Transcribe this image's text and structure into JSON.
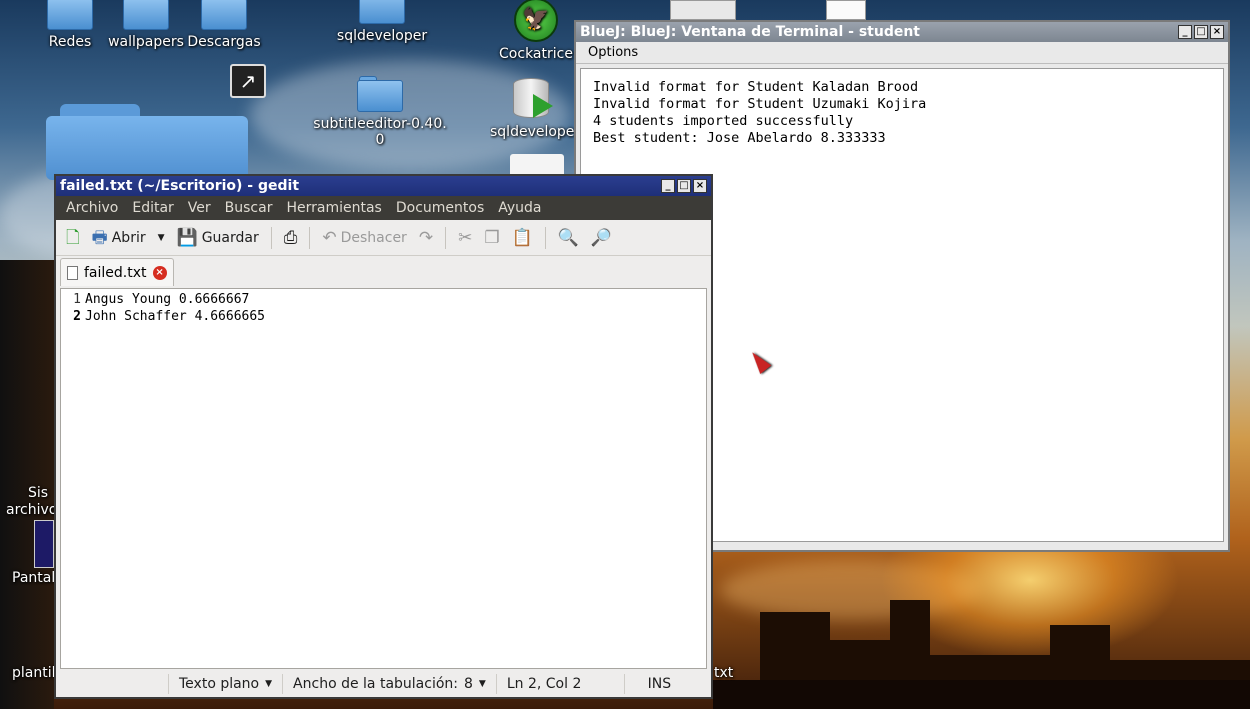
{
  "desktop": {
    "icons": [
      {
        "label": "Redes"
      },
      {
        "label": "wallpapers"
      },
      {
        "label": "Descargas"
      },
      {
        "label": "sqldeveloper"
      },
      {
        "label": "Cockatrice"
      },
      {
        "label": "subtitleeditor-0.40.\n0"
      },
      {
        "label": "sqldevelope"
      },
      {
        "label": "Sis"
      },
      {
        "label": "archivo"
      },
      {
        "label": "Pantal"
      },
      {
        "label": "plantil"
      },
      {
        "label": "txt"
      }
    ]
  },
  "bluej": {
    "title": "BlueJ: BlueJ:  Ventana de Terminal - student",
    "menu": {
      "options": "Options"
    },
    "terminal_lines": [
      "Invalid format for Student Kaladan Brood",
      "Invalid format for Student Uzumaki Kojira",
      "4 students imported successfully",
      "Best student: Jose Abelardo 8.333333"
    ]
  },
  "gedit": {
    "title": "failed.txt (~/Escritorio) - gedit",
    "menu": [
      "Archivo",
      "Editar",
      "Ver",
      "Buscar",
      "Herramientas",
      "Documentos",
      "Ayuda"
    ],
    "toolbar": {
      "open": "Abrir",
      "save": "Guardar",
      "undo": "Deshacer"
    },
    "tab": {
      "name": "failed.txt"
    },
    "lines": [
      {
        "num": "1",
        "text": "Angus Young 0.6666667"
      },
      {
        "num": "2",
        "text": "John Schaffer 4.6666665"
      }
    ],
    "status": {
      "language": "Texto plano",
      "tab_width_label": "Ancho de la tabulación:",
      "tab_width": "8",
      "position": "Ln 2, Col 2",
      "mode": "INS"
    }
  }
}
